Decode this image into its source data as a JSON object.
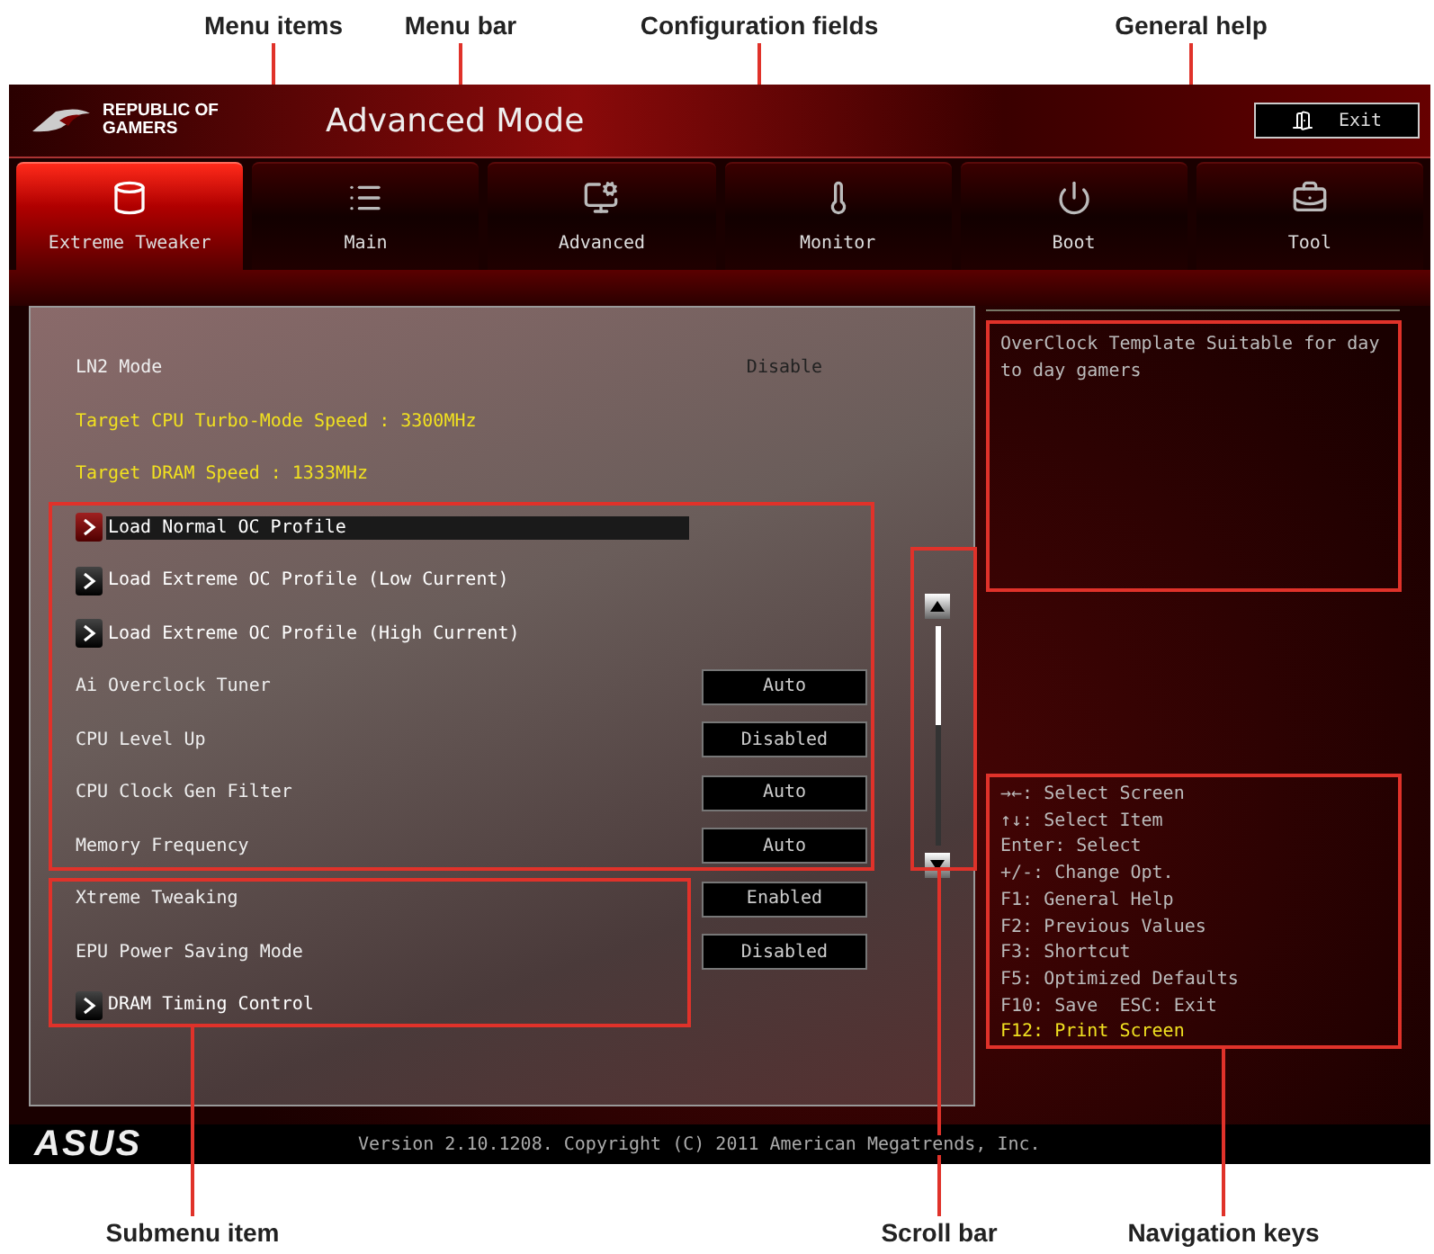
{
  "callouts_top": [
    {
      "label": "Menu items"
    },
    {
      "label": "Menu bar"
    },
    {
      "label": "Configuration fields"
    },
    {
      "label": "General help"
    }
  ],
  "header": {
    "brand": [
      "REPUBLIC OF",
      "GAMERS"
    ],
    "title": "Advanced Mode",
    "exit_button": "Exit"
  },
  "tabs": [
    {
      "label": "Extreme Tweaker",
      "selected": true
    },
    {
      "label": "Main",
      "selected": false
    },
    {
      "label": "Advanced",
      "selected": false
    },
    {
      "label": "Monitor",
      "selected": false
    },
    {
      "label": "Boot",
      "selected": false
    },
    {
      "label": "Tool",
      "selected": false
    }
  ],
  "settings": [
    {
      "kind": "setting",
      "label": "LN2 Mode",
      "value": "Disable"
    },
    {
      "kind": "info",
      "label": "Target CPU Turbo-Mode Speed : 3300MHz"
    },
    {
      "kind": "info",
      "label": "Target DRAM Speed : 1333MHz"
    },
    {
      "kind": "submenu",
      "label": "Load Normal OC Profile",
      "selected": true
    },
    {
      "kind": "submenu",
      "label": "Load Extreme OC Profile (Low Current)",
      "selected": false
    },
    {
      "kind": "submenu",
      "label": "Load Extreme OC Profile (High Current)",
      "selected": false
    },
    {
      "kind": "option",
      "label": "Ai Overclock Tuner",
      "value": "Auto"
    },
    {
      "kind": "option",
      "label": "CPU Level Up",
      "value": "Disabled"
    },
    {
      "kind": "option",
      "label": "CPU Clock Gen Filter",
      "value": "Auto"
    },
    {
      "kind": "option",
      "label": "Memory Frequency",
      "value": "Auto"
    },
    {
      "kind": "option",
      "label": "Xtreme Tweaking",
      "value": "Enabled"
    },
    {
      "kind": "option",
      "label": "EPU Power Saving Mode",
      "value": "Disabled"
    },
    {
      "kind": "submenu",
      "label": "DRAM Timing Control",
      "selected": false
    }
  ],
  "help": "OverClock Template Suitable for day to day gamers",
  "nav_keys": [
    {
      "text": "→←: Select Screen",
      "highlighted": false
    },
    {
      "text": "↑↓: Select Item",
      "highlighted": false
    },
    {
      "text": "Enter: Select",
      "highlighted": false
    },
    {
      "text": "+/-: Change Opt.",
      "highlighted": false
    },
    {
      "text": "F1: General Help",
      "highlighted": false
    },
    {
      "text": "F2: Previous Values",
      "highlighted": false
    },
    {
      "text": "F3: Shortcut",
      "highlighted": false
    },
    {
      "text": "F5: Optimized Defaults",
      "highlighted": false
    },
    {
      "text": "F10: Save  ESC: Exit",
      "highlighted": false
    },
    {
      "text": "F12: Print Screen",
      "highlighted": true
    }
  ],
  "footer": {
    "logo": "ASUS",
    "version": "Version 2.10.1208. Copyright (C) 2011 American Megatrends, Inc."
  },
  "callouts_bottom": [
    {
      "label": "Submenu item"
    },
    {
      "label": "Scroll bar"
    },
    {
      "label": "Navigation keys"
    }
  ]
}
